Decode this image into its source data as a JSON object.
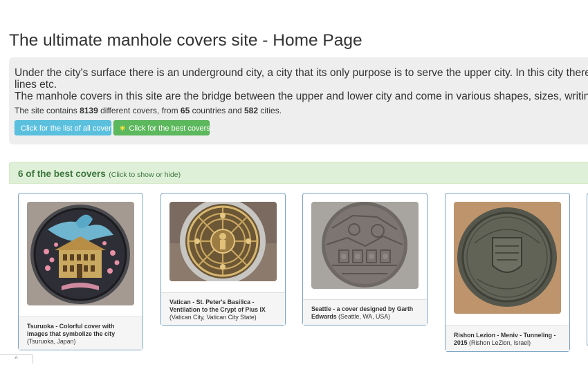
{
  "page": {
    "title": "The ultimate manhole covers site - Home Page"
  },
  "intro": {
    "line1": "Under the city's surface there is an underground city, a city that its only purpose is to serve the upper city. In this city there are",
    "line2": "lines etc.",
    "line3": "The manhole covers in this site are the bridge between the upper and lower city and come in various shapes, sizes, writing an",
    "stats_prefix": "The site contains ",
    "cover_count": "8139",
    "stats_mid1": " different covers, from ",
    "country_count": "65",
    "stats_mid2": " countries and ",
    "city_count": "582",
    "stats_suffix": " cities."
  },
  "buttons": {
    "all_covers": "Click for the list of all covers",
    "best_covers": "Click for the best covers",
    "best_icon": "star-icon"
  },
  "best_panel": {
    "title": "6 of the best covers",
    "hint": "(Click to show or hide)"
  },
  "covers": [
    {
      "title": "Tsuruoka - Colorful cover with images that symbolize the city",
      "location": "(Tsuruoka, Japan)"
    },
    {
      "title": "Vatican - St. Peter's Basilica - Ventilation to the Crypt of Pius IX",
      "location": "(Vatican City, Vatican City State)"
    },
    {
      "title": "Seattle - a cover designed by Garth Edwards",
      "location": "(Seattle, WA, USA)"
    },
    {
      "title": "Rishon Lezion - Meniv - Tunneling - 2015",
      "location": "(Rishon LeZion, Israel)"
    }
  ],
  "colors": {
    "info": "#5bc0de",
    "success": "#5cb85c",
    "panel_green": "#dff0d8",
    "jumbotron": "#eeeeee"
  }
}
